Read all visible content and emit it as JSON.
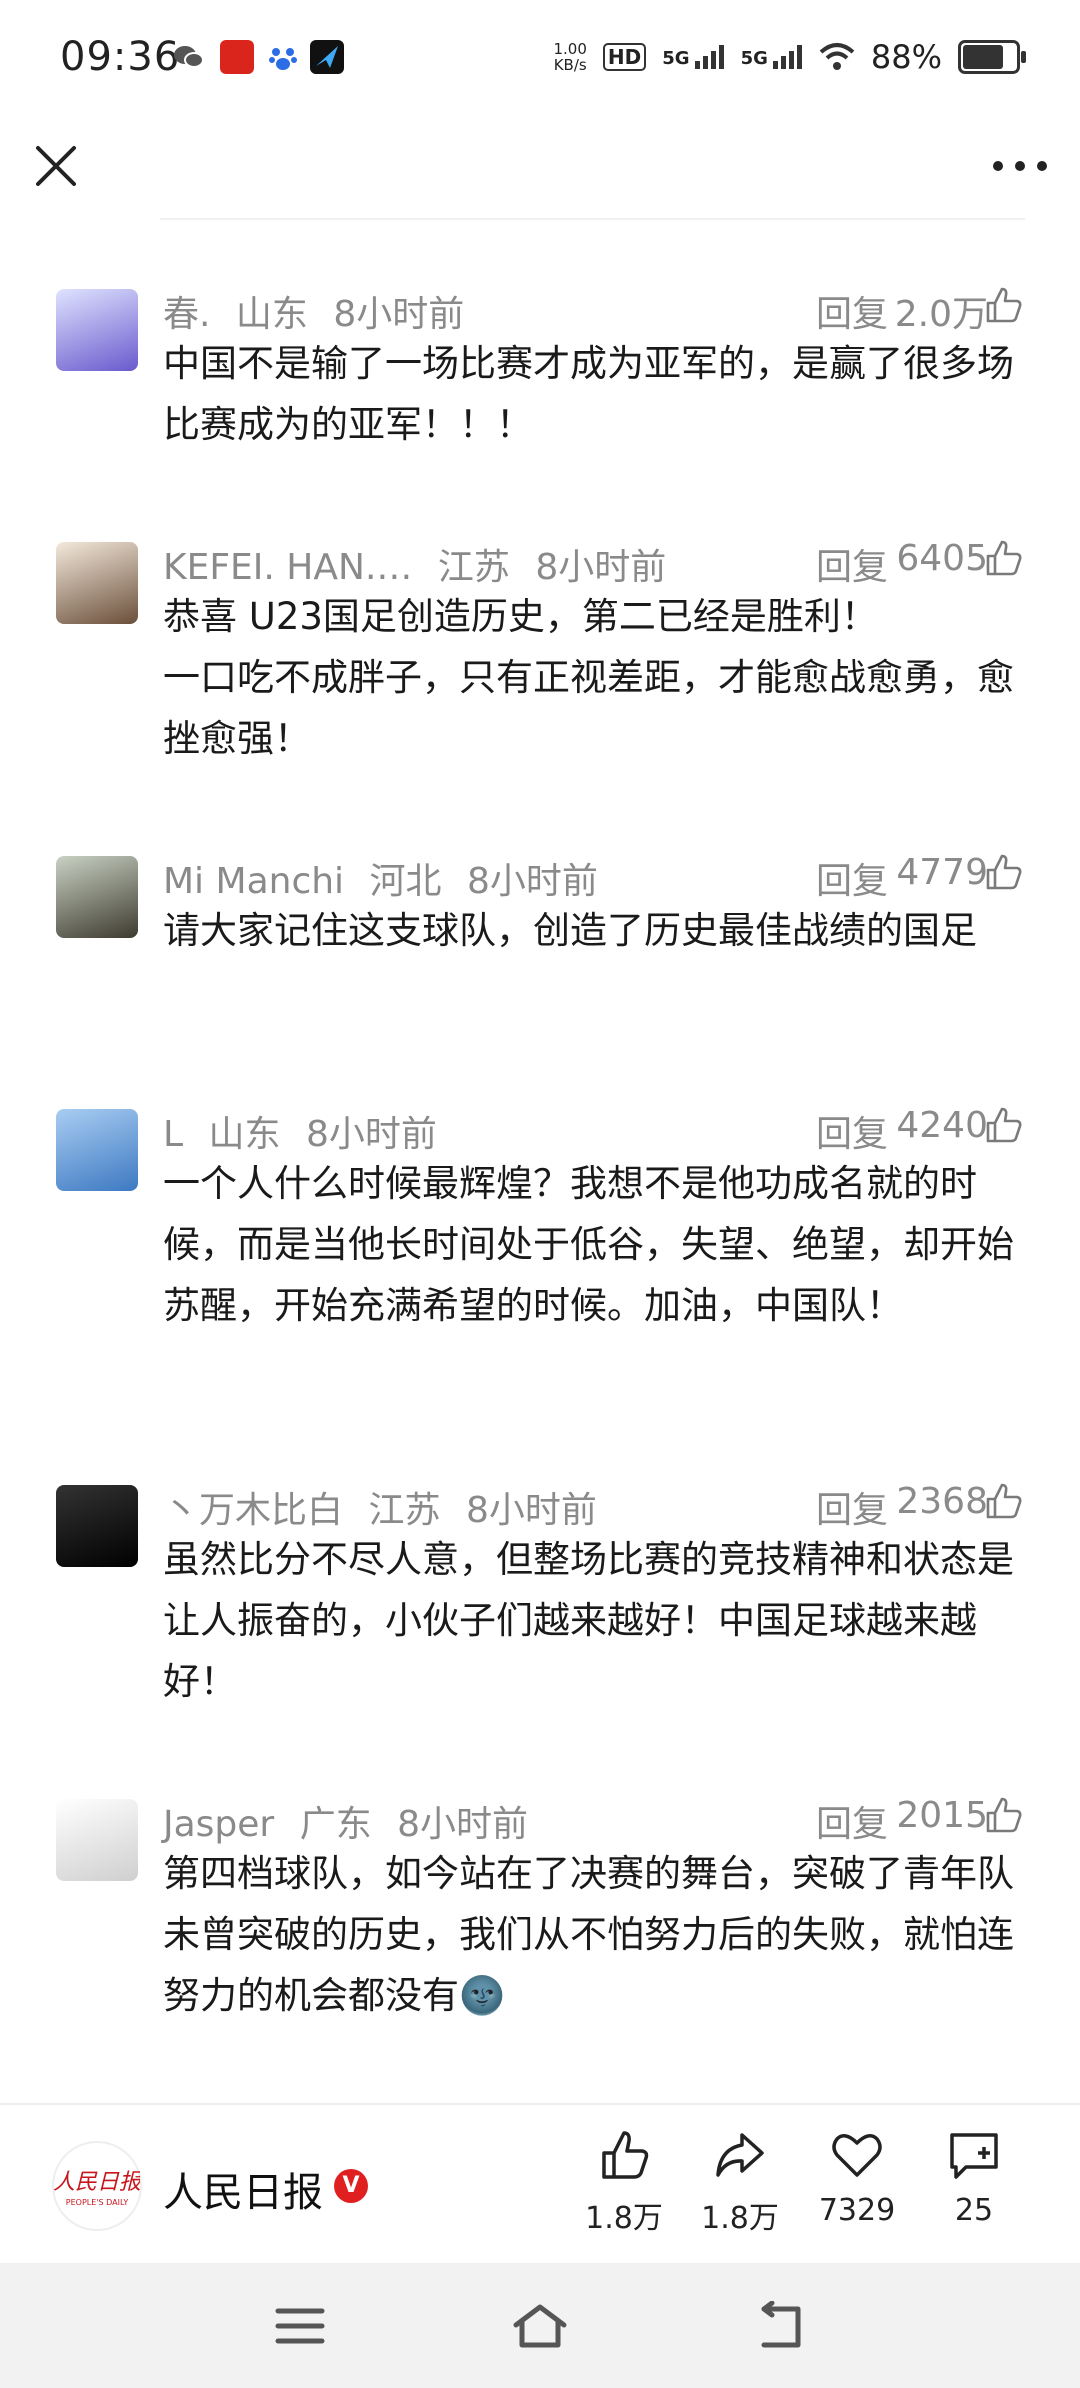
{
  "status_bar": {
    "time": "09:36",
    "net_speed_top": "1.00",
    "net_speed_bottom": "KB/s",
    "hd": "HD",
    "signal1": "5G",
    "signal2": "5G",
    "battery_pct": "88%",
    "battery_level": 0.88
  },
  "comments": [
    {
      "user": "春.",
      "region": "山东",
      "time": "8小时前",
      "reply": "回复",
      "likes": "2.0万",
      "text": "中国不是输了一场比赛才成为亚军的，是赢了很多场比赛成为的亚军！！！"
    },
    {
      "user": "KEFEI. HAN.…",
      "region": "江苏",
      "time": "8小时前",
      "reply": "回复",
      "likes": "6405",
      "text": "恭喜 U23国足创造历史，第二已经是胜利！\n一口吃不成胖子，只有正视差距，才能愈战愈勇，愈挫愈强！"
    },
    {
      "user": "Mi Manchi",
      "region": "河北",
      "time": "8小时前",
      "reply": "回复",
      "likes": "4779",
      "text": "请大家记住这支球队，创造了历史最佳战绩的国足"
    },
    {
      "user": "L",
      "region": "山东",
      "time": "8小时前",
      "reply": "回复",
      "likes": "4240",
      "text": "一个人什么时候最辉煌？我想不是他功成名就的时候，而是当他长时间处于低谷，失望、绝望，却开始苏醒，开始充满希望的时候。加油，中国队！"
    },
    {
      "user": "丶万木比白",
      "region": "江苏",
      "time": "8小时前",
      "reply": "回复",
      "likes": "2368",
      "text": "虽然比分不尽人意，但整场比赛的竞技精神和状态是让人振奋的，小伙子们越来越好！中国足球越来越好！"
    },
    {
      "user": "Jasper",
      "region": "广东",
      "time": "8小时前",
      "reply": "回复",
      "likes": "2015",
      "text": "第四档球队，如今站在了决赛的舞台，突破了青年队未曾突破的历史，我们从不怕努力后的失败，就怕连努力的机会都没有🌚"
    }
  ],
  "bottom_bar": {
    "publisher": "人民日报",
    "verified_mark": "V",
    "like_count": "1.8万",
    "share_count": "1.8万",
    "favorite_count": "7329",
    "comment_count": "25"
  }
}
